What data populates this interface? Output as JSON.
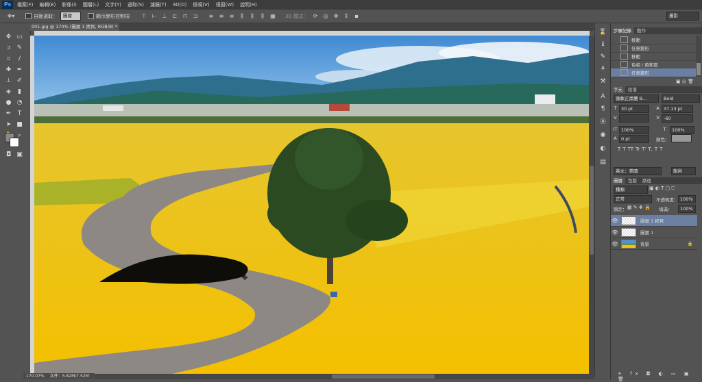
{
  "app": {
    "logo": "Ps"
  },
  "menu": [
    "檔案(F)",
    "編輯(E)",
    "影像(I)",
    "圖層(L)",
    "文字(Y)",
    "選取(S)",
    "濾鏡(T)",
    "3D(D)",
    "檢視(V)",
    "視窗(W)",
    "說明(H)"
  ],
  "options": {
    "auto_select_label": "自動選取：",
    "auto_select_value": "圖層",
    "transform_label": "顯示變形控制項",
    "mode_3d_label": "3D 模式：",
    "workspace": "攝影"
  },
  "document": {
    "tab_title": "001.jpg @ 170% (圖層 1 拷貝, RGB/8) *",
    "zoom": "170.07%",
    "doc_size": "文件：5.82M/7.52M"
  },
  "history": {
    "tabs": [
      "步驟記錄",
      "動作"
    ],
    "items": [
      "移動",
      "任意變形",
      "移動",
      "色相 / 飽和度",
      "任意變形"
    ],
    "active_index": 4
  },
  "character": {
    "tabs": [
      "字元",
      "段落"
    ],
    "font_family": "微軟正黑體 B...",
    "font_style": "Bold",
    "font_size": "30 pt",
    "leading": "37.13 pt",
    "kerning": "",
    "tracking": "-60",
    "vscale": "100%",
    "hscale": "100%",
    "baseline": "0 pt",
    "color_label": "顏色：",
    "language": "英文：美國",
    "aa": "銳利",
    "style_buttons": [
      "T",
      "T",
      "TT",
      "Tr",
      "T'",
      "T,",
      "T",
      "T"
    ]
  },
  "layers": {
    "tabs": [
      "圖層",
      "色版",
      "路徑"
    ],
    "filter": "種類",
    "blend": "正常",
    "opacity_label": "不透明度：",
    "opacity": "100%",
    "lock_label": "鎖定：",
    "fill_label": "填滿：",
    "fill": "100%",
    "items": [
      "圖層 1 拷貝",
      "圖層 1",
      "背景"
    ],
    "active_index": 0
  },
  "colors": {
    "sky": "#4f95d6",
    "field": "#f2c20c",
    "road": "#8b8680",
    "tree": "#2f4a24",
    "selection": "#6b7fa3"
  },
  "icons": [
    "move-tool-icon",
    "marquee-icon",
    "lasso-icon",
    "quick-select-icon",
    "crop-icon",
    "eyedropper-icon",
    "healing-icon",
    "brush-icon",
    "stamp-icon",
    "history-brush-icon",
    "eraser-icon",
    "gradient-icon",
    "blur-icon",
    "dodge-icon",
    "pen-icon",
    "type-icon",
    "path-select-icon",
    "shape-icon",
    "hand-icon",
    "zoom-icon"
  ]
}
